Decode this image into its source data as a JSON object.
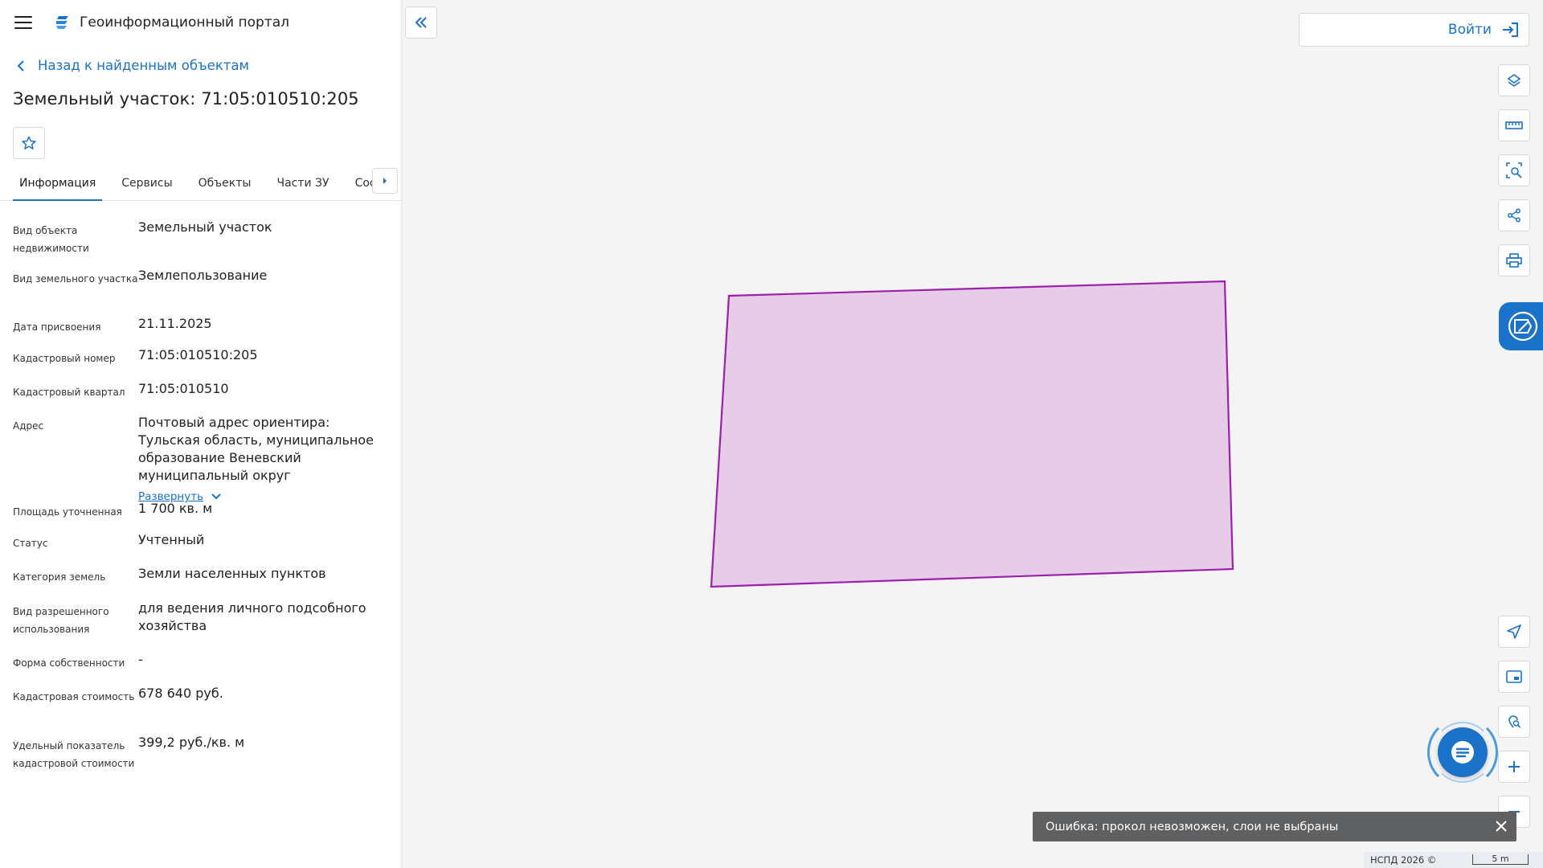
{
  "header": {
    "app_title": "Геоинформационный портал"
  },
  "nav": {
    "back_label": "Назад к найденным объектам"
  },
  "object": {
    "title": "Земельный участок: 71:05:010510:205"
  },
  "tabs": [
    {
      "label": "Информация",
      "active": true
    },
    {
      "label": "Сервисы"
    },
    {
      "label": "Объекты"
    },
    {
      "label": "Части ЗУ"
    },
    {
      "label": "Состав"
    }
  ],
  "properties": [
    {
      "label": "Вид объекта недвижимости",
      "value": "Земельный участок"
    },
    {
      "label": "Вид земельного участка",
      "value": "Землепользование"
    },
    {
      "label": "Дата присвоения",
      "value": "21.11.2025"
    },
    {
      "label": "Кадастровый номер",
      "value": "71:05:010510:205"
    },
    {
      "label": "Кадастровый квартал",
      "value": "71:05:010510"
    },
    {
      "label": "Адрес",
      "value": "Почтовый адрес ориентира: Тульская область, муниципальное образование Веневский муниципальный округ",
      "expand_label": "Развернуть"
    },
    {
      "label": "Площадь уточненная",
      "value": "1 700 кв. м"
    },
    {
      "label": "Статус",
      "value": "Учтенный"
    },
    {
      "label": "Категория земель",
      "value": "Земли населенных пунктов"
    },
    {
      "label": "Вид разрешенного использования",
      "value": "для ведения личного подсобного хозяйства"
    },
    {
      "label": "Форма собственности",
      "value": "-"
    },
    {
      "label": "Кадастровая стоимость",
      "value": "678 640 руб."
    },
    {
      "label": "Удельный показатель кадастровой стоимости",
      "value": "399,2 руб./кв. м"
    }
  ],
  "login": {
    "label": "Войти"
  },
  "toast": {
    "message": "Ошибка: прокол невозможен, слои не выбраны"
  },
  "footer": {
    "copyright": "НСПД 2026 ©",
    "scale": "5 m"
  },
  "colors": {
    "accent": "#1a73c8",
    "parcel_fill": "#e6cce6",
    "parcel_stroke": "#9c1fae"
  }
}
